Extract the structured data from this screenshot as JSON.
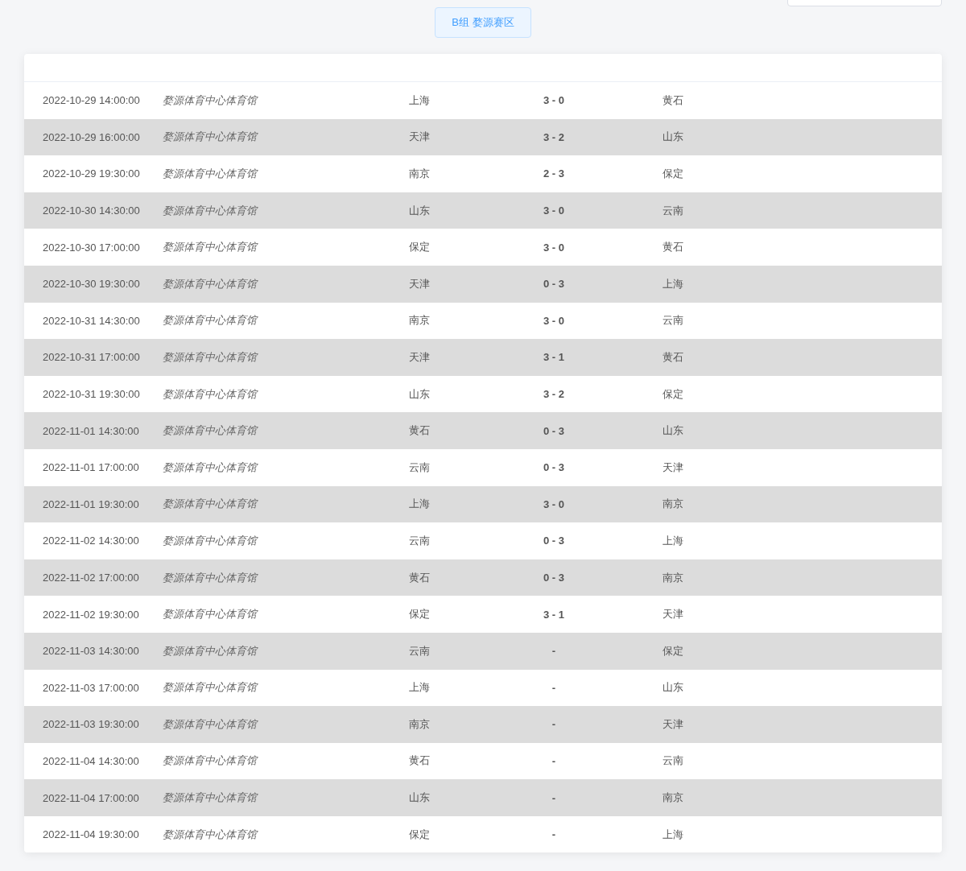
{
  "group_button": {
    "label": "B组 婺源赛区"
  },
  "matches": [
    {
      "time": "2022-10-29 14:00:00",
      "venue": "婺源体育中心体育馆",
      "home": "上海",
      "score": "3 - 0",
      "away": "黄石"
    },
    {
      "time": "2022-10-29 16:00:00",
      "venue": "婺源体育中心体育馆",
      "home": "天津",
      "score": "3 - 2",
      "away": "山东"
    },
    {
      "time": "2022-10-29 19:30:00",
      "venue": "婺源体育中心体育馆",
      "home": "南京",
      "score": "2 - 3",
      "away": "保定"
    },
    {
      "time": "2022-10-30 14:30:00",
      "venue": "婺源体育中心体育馆",
      "home": "山东",
      "score": "3 - 0",
      "away": "云南"
    },
    {
      "time": "2022-10-30 17:00:00",
      "venue": "婺源体育中心体育馆",
      "home": "保定",
      "score": "3 - 0",
      "away": "黄石"
    },
    {
      "time": "2022-10-30 19:30:00",
      "venue": "婺源体育中心体育馆",
      "home": "天津",
      "score": "0 - 3",
      "away": "上海"
    },
    {
      "time": "2022-10-31 14:30:00",
      "venue": "婺源体育中心体育馆",
      "home": "南京",
      "score": "3 - 0",
      "away": "云南"
    },
    {
      "time": "2022-10-31 17:00:00",
      "venue": "婺源体育中心体育馆",
      "home": "天津",
      "score": "3 - 1",
      "away": "黄石"
    },
    {
      "time": "2022-10-31 19:30:00",
      "venue": "婺源体育中心体育馆",
      "home": "山东",
      "score": "3 - 2",
      "away": "保定"
    },
    {
      "time": "2022-11-01 14:30:00",
      "venue": "婺源体育中心体育馆",
      "home": "黄石",
      "score": "0 - 3",
      "away": "山东"
    },
    {
      "time": "2022-11-01 17:00:00",
      "venue": "婺源体育中心体育馆",
      "home": "云南",
      "score": "0 - 3",
      "away": "天津"
    },
    {
      "time": "2022-11-01 19:30:00",
      "venue": "婺源体育中心体育馆",
      "home": "上海",
      "score": "3 - 0",
      "away": "南京"
    },
    {
      "time": "2022-11-02 14:30:00",
      "venue": "婺源体育中心体育馆",
      "home": "云南",
      "score": "0 - 3",
      "away": "上海"
    },
    {
      "time": "2022-11-02 17:00:00",
      "venue": "婺源体育中心体育馆",
      "home": "黄石",
      "score": "0 - 3",
      "away": "南京"
    },
    {
      "time": "2022-11-02 19:30:00",
      "venue": "婺源体育中心体育馆",
      "home": "保定",
      "score": "3 - 1",
      "away": "天津"
    },
    {
      "time": "2022-11-03 14:30:00",
      "venue": "婺源体育中心体育馆",
      "home": "云南",
      "score": "-",
      "away": "保定"
    },
    {
      "time": "2022-11-03 17:00:00",
      "venue": "婺源体育中心体育馆",
      "home": "上海",
      "score": "-",
      "away": "山东"
    },
    {
      "time": "2022-11-03 19:30:00",
      "venue": "婺源体育中心体育馆",
      "home": "南京",
      "score": "-",
      "away": "天津"
    },
    {
      "time": "2022-11-04 14:30:00",
      "venue": "婺源体育中心体育馆",
      "home": "黄石",
      "score": "-",
      "away": "云南"
    },
    {
      "time": "2022-11-04 17:00:00",
      "venue": "婺源体育中心体育馆",
      "home": "山东",
      "score": "-",
      "away": "南京"
    },
    {
      "time": "2022-11-04 19:30:00",
      "venue": "婺源体育中心体育馆",
      "home": "保定",
      "score": "-",
      "away": "上海"
    }
  ]
}
